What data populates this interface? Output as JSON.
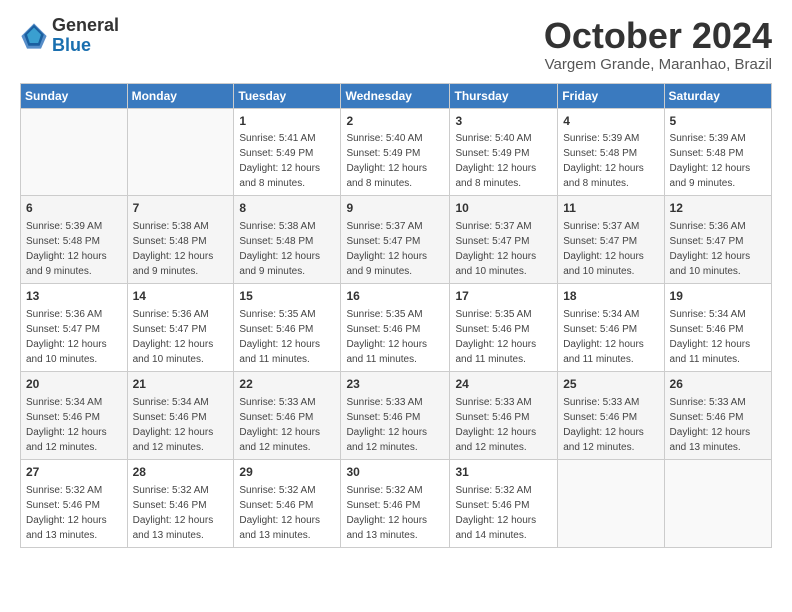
{
  "logo": {
    "general": "General",
    "blue": "Blue"
  },
  "title": "October 2024",
  "location": "Vargem Grande, Maranhao, Brazil",
  "days_of_week": [
    "Sunday",
    "Monday",
    "Tuesday",
    "Wednesday",
    "Thursday",
    "Friday",
    "Saturday"
  ],
  "weeks": [
    [
      {
        "day": "",
        "sunrise": "",
        "sunset": "",
        "daylight": ""
      },
      {
        "day": "",
        "sunrise": "",
        "sunset": "",
        "daylight": ""
      },
      {
        "day": "1",
        "sunrise": "Sunrise: 5:41 AM",
        "sunset": "Sunset: 5:49 PM",
        "daylight": "Daylight: 12 hours and 8 minutes."
      },
      {
        "day": "2",
        "sunrise": "Sunrise: 5:40 AM",
        "sunset": "Sunset: 5:49 PM",
        "daylight": "Daylight: 12 hours and 8 minutes."
      },
      {
        "day": "3",
        "sunrise": "Sunrise: 5:40 AM",
        "sunset": "Sunset: 5:49 PM",
        "daylight": "Daylight: 12 hours and 8 minutes."
      },
      {
        "day": "4",
        "sunrise": "Sunrise: 5:39 AM",
        "sunset": "Sunset: 5:48 PM",
        "daylight": "Daylight: 12 hours and 8 minutes."
      },
      {
        "day": "5",
        "sunrise": "Sunrise: 5:39 AM",
        "sunset": "Sunset: 5:48 PM",
        "daylight": "Daylight: 12 hours and 9 minutes."
      }
    ],
    [
      {
        "day": "6",
        "sunrise": "Sunrise: 5:39 AM",
        "sunset": "Sunset: 5:48 PM",
        "daylight": "Daylight: 12 hours and 9 minutes."
      },
      {
        "day": "7",
        "sunrise": "Sunrise: 5:38 AM",
        "sunset": "Sunset: 5:48 PM",
        "daylight": "Daylight: 12 hours and 9 minutes."
      },
      {
        "day": "8",
        "sunrise": "Sunrise: 5:38 AM",
        "sunset": "Sunset: 5:48 PM",
        "daylight": "Daylight: 12 hours and 9 minutes."
      },
      {
        "day": "9",
        "sunrise": "Sunrise: 5:37 AM",
        "sunset": "Sunset: 5:47 PM",
        "daylight": "Daylight: 12 hours and 9 minutes."
      },
      {
        "day": "10",
        "sunrise": "Sunrise: 5:37 AM",
        "sunset": "Sunset: 5:47 PM",
        "daylight": "Daylight: 12 hours and 10 minutes."
      },
      {
        "day": "11",
        "sunrise": "Sunrise: 5:37 AM",
        "sunset": "Sunset: 5:47 PM",
        "daylight": "Daylight: 12 hours and 10 minutes."
      },
      {
        "day": "12",
        "sunrise": "Sunrise: 5:36 AM",
        "sunset": "Sunset: 5:47 PM",
        "daylight": "Daylight: 12 hours and 10 minutes."
      }
    ],
    [
      {
        "day": "13",
        "sunrise": "Sunrise: 5:36 AM",
        "sunset": "Sunset: 5:47 PM",
        "daylight": "Daylight: 12 hours and 10 minutes."
      },
      {
        "day": "14",
        "sunrise": "Sunrise: 5:36 AM",
        "sunset": "Sunset: 5:47 PM",
        "daylight": "Daylight: 12 hours and 10 minutes."
      },
      {
        "day": "15",
        "sunrise": "Sunrise: 5:35 AM",
        "sunset": "Sunset: 5:46 PM",
        "daylight": "Daylight: 12 hours and 11 minutes."
      },
      {
        "day": "16",
        "sunrise": "Sunrise: 5:35 AM",
        "sunset": "Sunset: 5:46 PM",
        "daylight": "Daylight: 12 hours and 11 minutes."
      },
      {
        "day": "17",
        "sunrise": "Sunrise: 5:35 AM",
        "sunset": "Sunset: 5:46 PM",
        "daylight": "Daylight: 12 hours and 11 minutes."
      },
      {
        "day": "18",
        "sunrise": "Sunrise: 5:34 AM",
        "sunset": "Sunset: 5:46 PM",
        "daylight": "Daylight: 12 hours and 11 minutes."
      },
      {
        "day": "19",
        "sunrise": "Sunrise: 5:34 AM",
        "sunset": "Sunset: 5:46 PM",
        "daylight": "Daylight: 12 hours and 11 minutes."
      }
    ],
    [
      {
        "day": "20",
        "sunrise": "Sunrise: 5:34 AM",
        "sunset": "Sunset: 5:46 PM",
        "daylight": "Daylight: 12 hours and 12 minutes."
      },
      {
        "day": "21",
        "sunrise": "Sunrise: 5:34 AM",
        "sunset": "Sunset: 5:46 PM",
        "daylight": "Daylight: 12 hours and 12 minutes."
      },
      {
        "day": "22",
        "sunrise": "Sunrise: 5:33 AM",
        "sunset": "Sunset: 5:46 PM",
        "daylight": "Daylight: 12 hours and 12 minutes."
      },
      {
        "day": "23",
        "sunrise": "Sunrise: 5:33 AM",
        "sunset": "Sunset: 5:46 PM",
        "daylight": "Daylight: 12 hours and 12 minutes."
      },
      {
        "day": "24",
        "sunrise": "Sunrise: 5:33 AM",
        "sunset": "Sunset: 5:46 PM",
        "daylight": "Daylight: 12 hours and 12 minutes."
      },
      {
        "day": "25",
        "sunrise": "Sunrise: 5:33 AM",
        "sunset": "Sunset: 5:46 PM",
        "daylight": "Daylight: 12 hours and 12 minutes."
      },
      {
        "day": "26",
        "sunrise": "Sunrise: 5:33 AM",
        "sunset": "Sunset: 5:46 PM",
        "daylight": "Daylight: 12 hours and 13 minutes."
      }
    ],
    [
      {
        "day": "27",
        "sunrise": "Sunrise: 5:32 AM",
        "sunset": "Sunset: 5:46 PM",
        "daylight": "Daylight: 12 hours and 13 minutes."
      },
      {
        "day": "28",
        "sunrise": "Sunrise: 5:32 AM",
        "sunset": "Sunset: 5:46 PM",
        "daylight": "Daylight: 12 hours and 13 minutes."
      },
      {
        "day": "29",
        "sunrise": "Sunrise: 5:32 AM",
        "sunset": "Sunset: 5:46 PM",
        "daylight": "Daylight: 12 hours and 13 minutes."
      },
      {
        "day": "30",
        "sunrise": "Sunrise: 5:32 AM",
        "sunset": "Sunset: 5:46 PM",
        "daylight": "Daylight: 12 hours and 13 minutes."
      },
      {
        "day": "31",
        "sunrise": "Sunrise: 5:32 AM",
        "sunset": "Sunset: 5:46 PM",
        "daylight": "Daylight: 12 hours and 14 minutes."
      },
      {
        "day": "",
        "sunrise": "",
        "sunset": "",
        "daylight": ""
      },
      {
        "day": "",
        "sunrise": "",
        "sunset": "",
        "daylight": ""
      }
    ]
  ]
}
